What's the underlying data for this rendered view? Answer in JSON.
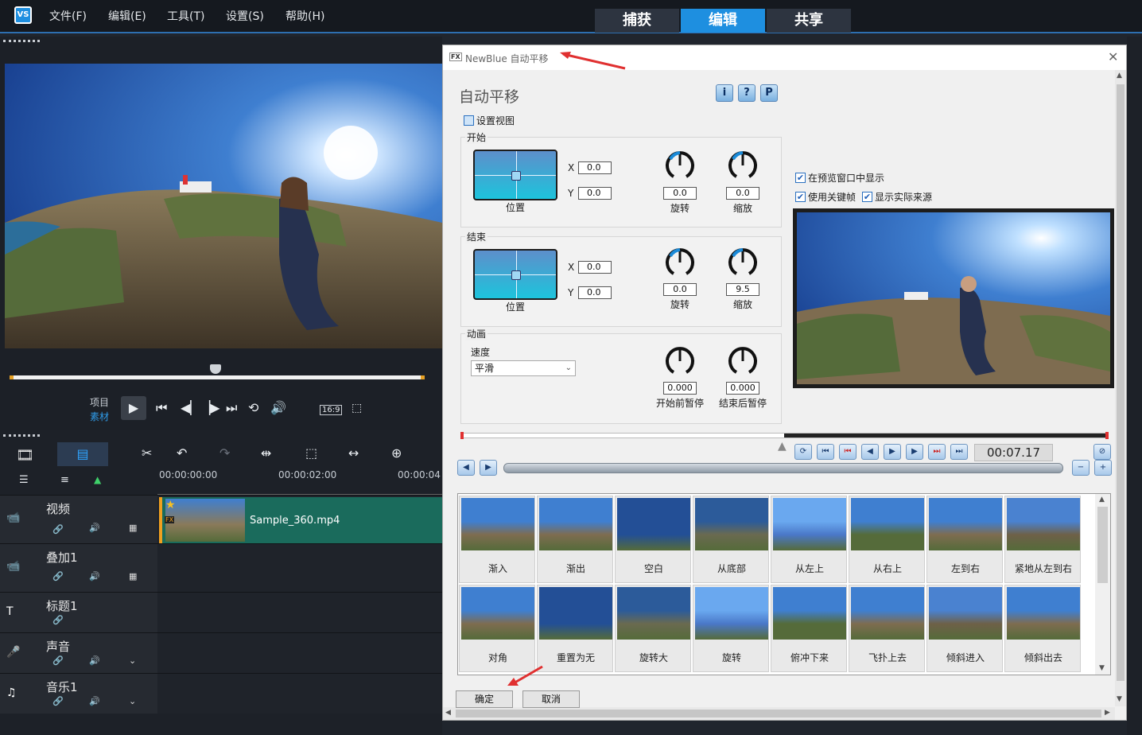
{
  "menubar": {
    "logo": "VS",
    "items": [
      "文件(F)",
      "编辑(E)",
      "工具(T)",
      "设置(S)",
      "帮助(H)"
    ],
    "tabs": [
      "捕获",
      "编辑",
      "共享"
    ],
    "active_tab": "编辑"
  },
  "player": {
    "project_label": "项目",
    "clip_label": "素材",
    "aspect": "16:9"
  },
  "timeline": {
    "times": [
      "00:00:00:00",
      "00:00:02:00",
      "00:00:04"
    ],
    "tracks": [
      {
        "name": "视频"
      },
      {
        "name": "叠加1"
      },
      {
        "name": "标题1"
      },
      {
        "name": "声音"
      },
      {
        "name": "音乐1"
      }
    ],
    "clip_name": "Sample_360.mp4",
    "fx_label": "FX"
  },
  "dialog": {
    "title": "NewBlue 自动平移",
    "heading": "自动平移",
    "fx_icon": "FX",
    "help_buttons": [
      "i",
      "?",
      "P"
    ],
    "set_view_label": "设置视图",
    "start": {
      "label": "开始",
      "x": "0.0",
      "y": "0.0",
      "rotate": "0.0",
      "zoom": "0.0",
      "rotate_frac": 0.0,
      "zoom_frac": 0.0
    },
    "end": {
      "label": "结束",
      "x": "0.0",
      "y": "0.0",
      "rotate": "0.0",
      "zoom": "9.5",
      "rotate_frac": 0.0,
      "zoom_frac": 0.095
    },
    "x_label": "X",
    "y_label": "Y",
    "position_label": "位置",
    "rotate_label": "旋转",
    "zoom_label": "缩放",
    "animation": {
      "label": "动画",
      "speed_label": "速度",
      "speed_value": "平滑",
      "pause_before_label": "开始前暂停",
      "pause_before": "0.000",
      "pause_after_label": "结束后暂停",
      "pause_after": "0.000"
    },
    "options": [
      {
        "label": "在预览窗口中显示",
        "checked": true
      },
      {
        "label": "使用关键帧",
        "checked": true
      },
      {
        "label": "显示实际来源",
        "checked": true
      }
    ],
    "timecode": "00:07.17",
    "presets": [
      "渐入",
      "渐出",
      "空白",
      "从底部",
      "从左上",
      "从右上",
      "左到右",
      "紧地从左到右",
      "对角",
      "重置为无",
      "旋转大",
      "旋转",
      "俯冲下来",
      "飞扑上去",
      "倾斜进入",
      "倾斜出去"
    ],
    "ok_label": "确定",
    "cancel_label": "取消"
  },
  "colors": {
    "accent": "#1e8fe0",
    "clip": "#1a6b5c",
    "playhead": "#e03030"
  }
}
